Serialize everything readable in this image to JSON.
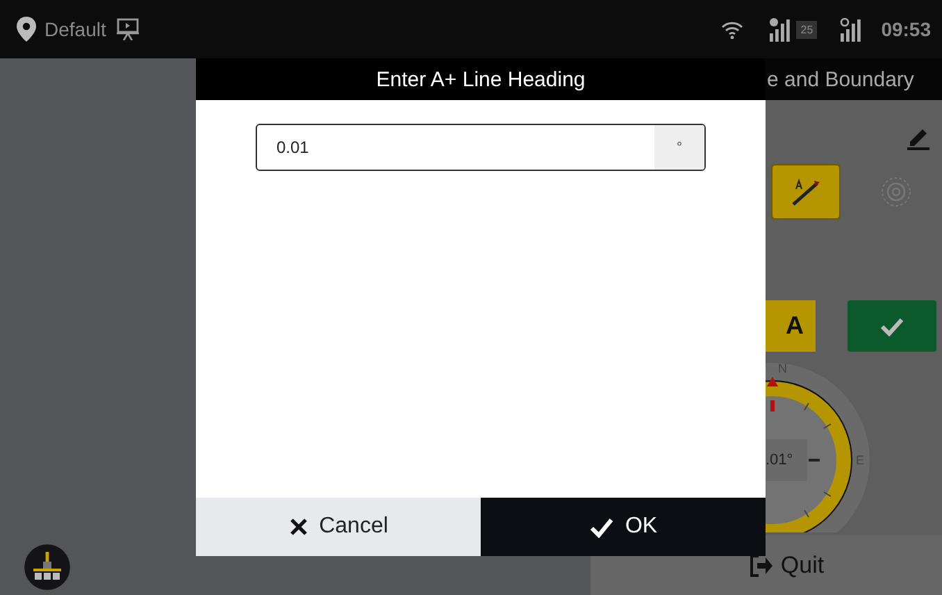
{
  "status_bar": {
    "location": "Default",
    "signal_badge": "25",
    "time": "09:53"
  },
  "background": {
    "panel_title": "e and Boundary",
    "a_button": "A",
    "compass": {
      "north": "N",
      "east": "E",
      "reading": ".01°"
    },
    "quit": "Quit"
  },
  "dialog": {
    "title": "Enter A+ Line Heading",
    "field": {
      "value": "0.01",
      "unit": "°"
    },
    "buttons": [
      {
        "label": "Cancel",
        "kind": "cancel"
      },
      {
        "label": "OK",
        "kind": "ok"
      }
    ]
  }
}
